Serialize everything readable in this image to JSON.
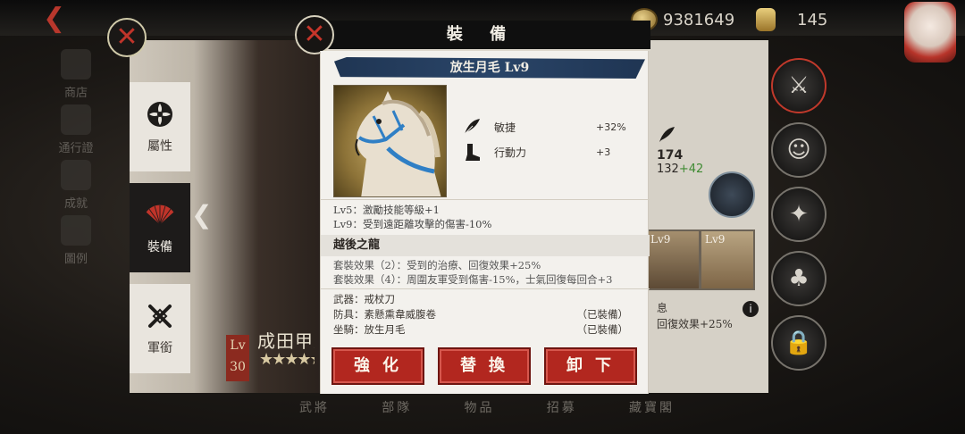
{
  "top": {
    "back_icon": "back-arrow-icon",
    "coins": "9381649",
    "gold": "145"
  },
  "left_nav": [
    "商店",
    "通行證",
    "成就",
    "圖例"
  ],
  "sidebar_tabs": [
    {
      "label": "屬性",
      "icon": "attribute-flower-icon"
    },
    {
      "label": "裝備",
      "icon": "equipment-fan-icon",
      "active": true
    },
    {
      "label": "軍銜",
      "icon": "crossed-swords-icon"
    }
  ],
  "character": {
    "level_prefix": "Lv",
    "level": "30",
    "name": "成田甲斐",
    "stars": "★★★★★"
  },
  "right_panel": {
    "stat_main": "174",
    "stat_base": "132",
    "stat_bonus": "+42",
    "card_horse_level": "Lv9",
    "card_book_level": "Lv9",
    "text_line1": "息",
    "text_line2": "回復效果+25%"
  },
  "bottom_tabs": [
    "武將",
    "部隊",
    "物品",
    "招募",
    "藏寶閣"
  ],
  "modal": {
    "title": "裝 備",
    "item_name": "放生月毛 Lv9",
    "stats": [
      {
        "name": "敏捷",
        "value": "+32%",
        "icon": "feather-icon"
      },
      {
        "name": "行動力",
        "value": "+3",
        "icon": "boot-icon"
      }
    ],
    "level_effects": [
      "Lv5：激勵技能等級+1",
      "Lv9：受到遠距離攻擊的傷害-10%"
    ],
    "set_name": "越後之龍",
    "set_effects": [
      "套裝效果（2）：受到的治療、回復效果+25%",
      "套裝效果（4）：周圍友軍受到傷害-15%，士氣回復每回合+3"
    ],
    "gear": [
      {
        "text": "武器：戒杖刀",
        "status": ""
      },
      {
        "text": "防具：素懸熏韋威腹卷",
        "status": "（已裝備）"
      },
      {
        "text": "坐騎：放生月毛",
        "status": "（已裝備）"
      }
    ],
    "buttons": {
      "enhance": "強化",
      "replace": "替換",
      "unequip": "卸下"
    }
  },
  "colors": {
    "accent_red": "#b2271f",
    "banner_blue": "#1f3553",
    "modal_bg": "#f3f1ed"
  }
}
